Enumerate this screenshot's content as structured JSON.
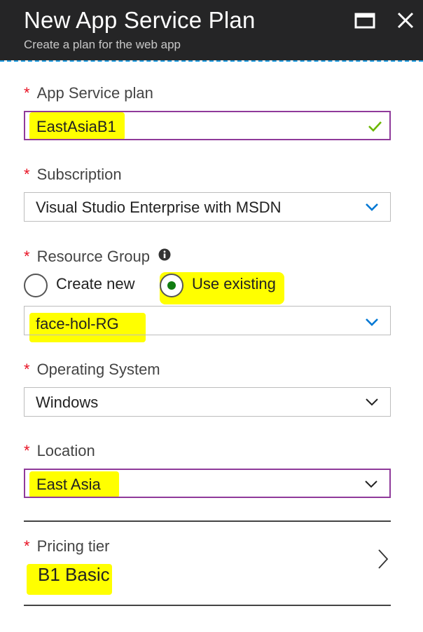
{
  "header": {
    "title": "New App Service Plan",
    "subtitle": "Create a plan for the web app",
    "maximize_icon": "maximize-icon",
    "close_icon": "close-icon"
  },
  "form": {
    "required_marker": "*",
    "app_service_plan": {
      "label": "App Service plan",
      "value": "EastAsiaB1",
      "status_icon": "checkmark-icon"
    },
    "subscription": {
      "label": "Subscription",
      "value": "Visual Studio Enterprise with MSDN"
    },
    "resource_group": {
      "label": "Resource Group",
      "info_icon": "info-icon",
      "options": [
        "Create new",
        "Use existing"
      ],
      "selected": "Use existing",
      "value": "face-hol-RG"
    },
    "operating_system": {
      "label": "Operating System",
      "value": "Windows"
    },
    "location": {
      "label": "Location",
      "value": "East Asia"
    },
    "pricing_tier": {
      "label": "Pricing tier",
      "value": "B1 Basic"
    }
  },
  "colors": {
    "header_bg": "#252526",
    "required": "#e81123",
    "focus_border": "#8f3a9a",
    "check": "#6bb700",
    "chevron_blue": "#0078d4",
    "radio_selected": "#107c10",
    "highlight": "#ffff00"
  }
}
